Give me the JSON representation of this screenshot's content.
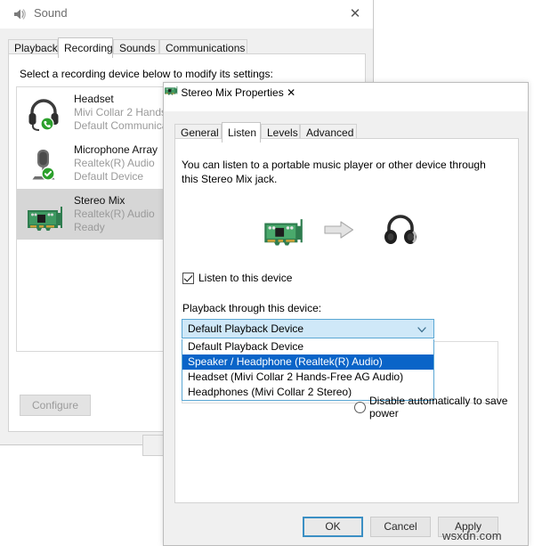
{
  "sound_window": {
    "title": "Sound",
    "icon": "speaker-icon",
    "close_label": "✕",
    "tabs": [
      {
        "label": "Playback",
        "active": false
      },
      {
        "label": "Recording",
        "active": true
      },
      {
        "label": "Sounds",
        "active": false
      },
      {
        "label": "Communications",
        "active": false
      }
    ],
    "hint": "Select a recording device below to modify its settings:",
    "devices": [
      {
        "name": "Headset",
        "driver": "Mivi Collar 2 Hands",
        "status": "Default Communica",
        "icon": "headset-icon",
        "badge": "phone-badge",
        "selected": false
      },
      {
        "name": "Microphone Array",
        "driver": "Realtek(R) Audio",
        "status": "Default Device",
        "icon": "microphone-icon",
        "badge": "check-badge",
        "selected": false
      },
      {
        "name": "Stereo Mix",
        "driver": "Realtek(R) Audio",
        "status": "Ready",
        "icon": "soundcard-icon",
        "badge": "none",
        "selected": true
      }
    ],
    "configure_label": "Configure"
  },
  "props_window": {
    "title": "Stereo Mix Properties",
    "icon": "soundcard-icon",
    "close_label": "✕",
    "tabs": [
      {
        "label": "General",
        "active": false
      },
      {
        "label": "Listen",
        "active": true
      },
      {
        "label": "Levels",
        "active": false
      },
      {
        "label": "Advanced",
        "active": false
      }
    ],
    "body_text": "You can listen to a portable music player or other device through this Stereo Mix jack.",
    "listen_checkbox": {
      "label": "Listen to this device",
      "checked": true
    },
    "playback_label": "Playback through this device:",
    "combobox": {
      "value": "Default Playback Device",
      "expanded": true,
      "options": [
        {
          "label": "Default Playback Device",
          "highlighted": false
        },
        {
          "label": "Speaker / Headphone (Realtek(R) Audio)",
          "highlighted": true
        },
        {
          "label": "Headset (Mivi Collar 2 Hands-Free AG Audio)",
          "highlighted": false
        },
        {
          "label": "Headphones (Mivi Collar 2 Stereo)",
          "highlighted": false
        }
      ]
    },
    "power_radio": {
      "label": "Disable automatically to save power",
      "selected": false
    },
    "buttons": {
      "ok": "OK",
      "cancel": "Cancel",
      "apply": "Apply"
    }
  },
  "watermark": "wsxdn.com",
  "colors": {
    "highlight_blue": "#0a64c8",
    "combo_border": "#5aa7d4",
    "combo_fill": "#cfe8f8",
    "selected_row": "#d6d6d6",
    "window_bg": "#f0f0f0",
    "badge_green": "#2ca02c"
  }
}
